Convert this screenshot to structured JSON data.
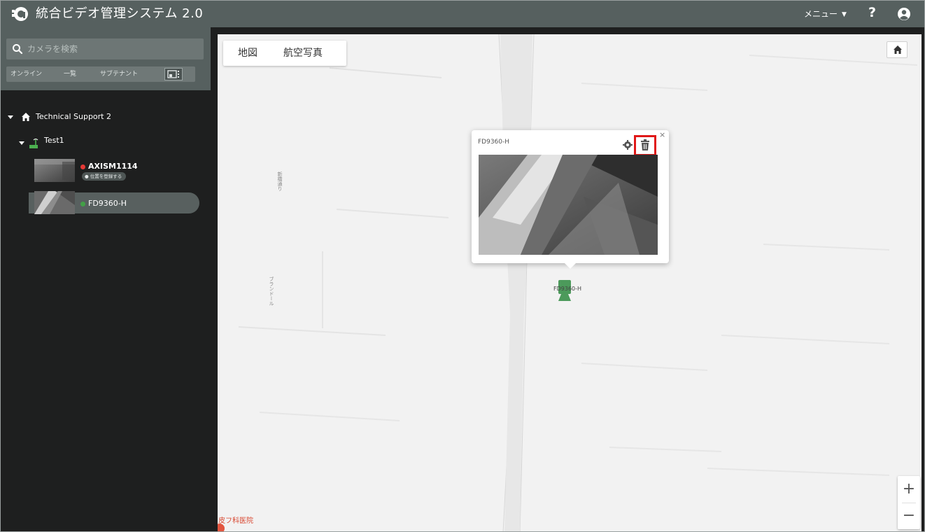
{
  "header": {
    "title": "統合ビデオ管理システム 2.0",
    "menu_label": "メニュー",
    "help_label": "?"
  },
  "sidebar": {
    "search_placeholder": "カメラを検索",
    "filters": [
      "オンライン",
      "一覧",
      "サブテナント"
    ],
    "tree": {
      "root_label": "Technical Support 2",
      "group_label": "Test1",
      "cameras": [
        {
          "name": "AXISM1114",
          "status": "offline",
          "status_color": "#e53935",
          "badge": "位置を登録する"
        },
        {
          "name": "FD9360-H",
          "status": "online",
          "status_color": "#43a047",
          "selected": true
        }
      ]
    }
  },
  "map": {
    "tabs": [
      "地図",
      "航空写真"
    ],
    "zoom_in": "+",
    "zoom_out": "−",
    "poi_label": "皮フ科医院",
    "marker_label": "FD9360-H",
    "road_labels": [
      "新橋通り",
      "ブランドール"
    ]
  },
  "popup": {
    "title": "FD9360-H",
    "close": "×"
  },
  "icons": {
    "search": "search-icon",
    "home": "home-icon",
    "settings": "gear-icon",
    "delete": "trash-icon",
    "user": "user-circle-icon"
  },
  "colors": {
    "header_bg": "#56605f",
    "sidebar_bg": "#1e1f1f",
    "highlight": "#e01818",
    "online": "#43a047",
    "offline": "#e53935",
    "marker": "#4c9a5b"
  }
}
